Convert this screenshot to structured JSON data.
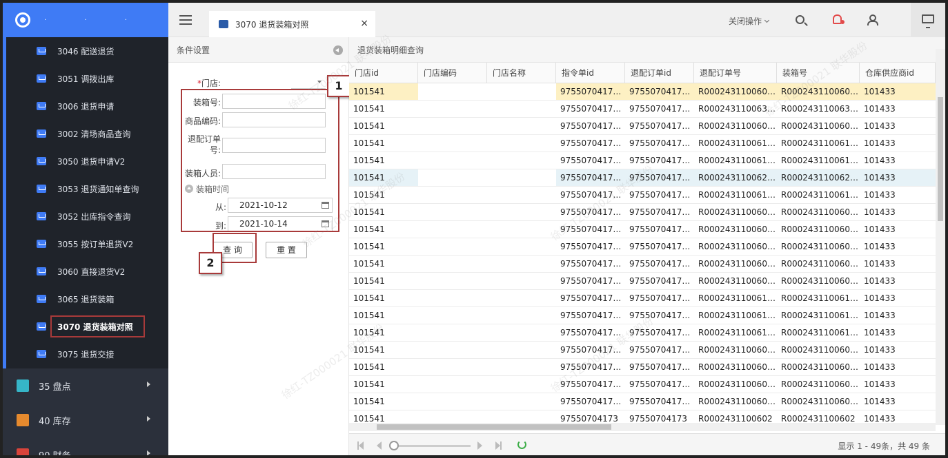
{
  "sidebar": {
    "logo_dots": "· · ·",
    "submenu": [
      {
        "label": "3046 配送退货"
      },
      {
        "label": "3051 调拨出库"
      },
      {
        "label": "3006 退货申请"
      },
      {
        "label": "3002 清场商品查询"
      },
      {
        "label": "3050 退货申请V2"
      },
      {
        "label": "3053 退货通知单查询"
      },
      {
        "label": "3052 出库指令查询"
      },
      {
        "label": "3055 按订单退货V2"
      },
      {
        "label": "3060 直接退货V2"
      },
      {
        "label": "3065 退货装箱"
      },
      {
        "label": "3070 退货装箱对照",
        "active": true
      },
      {
        "label": "3075 退货交接"
      }
    ],
    "groups": [
      {
        "label": "35 盘点",
        "color": "#36b5c8"
      },
      {
        "label": "40 库存",
        "color": "#e68a2e"
      },
      {
        "label": "90 财务",
        "color": "#d9443b"
      }
    ]
  },
  "topbar": {
    "tab_label": "3070 退货装箱对照",
    "tab_close": "×",
    "close_ops": "关闭操作"
  },
  "left_panel": {
    "title": "条件设置",
    "store_label": "门店:",
    "store_required": "*",
    "fields": [
      {
        "label": "装箱号:",
        "value": ""
      },
      {
        "label": "商品编码:",
        "value": ""
      },
      {
        "label": "退配订单号:",
        "value": ""
      },
      {
        "label": "装箱人员:",
        "value": ""
      }
    ],
    "time_group": "装箱时间",
    "from_label": "从:",
    "from_value": "2021-10-12",
    "to_label": "到:",
    "to_value": "2021-10-14",
    "query_btn": "查 询",
    "reset_btn": "重 置"
  },
  "callouts": [
    "1",
    "2"
  ],
  "right_panel": {
    "title": "退货装箱明细查询",
    "columns": [
      "门店id",
      "门店编码",
      "门店名称",
      "指令单id",
      "退配订单id",
      "退配订单号",
      "装箱号",
      "仓库供应商id"
    ],
    "rows": [
      [
        "101541",
        "",
        "",
        "97550704173...",
        "97550704173...",
        "R0002431100602...",
        "R0002431100602...",
        "101433"
      ],
      [
        "101541",
        "",
        "",
        "97550704173...",
        "97550704173...",
        "R0002431100636...",
        "R0002431100636...",
        "101433"
      ],
      [
        "101541",
        "",
        "",
        "97550704173...",
        "97550704173...",
        "R0002431100607...",
        "R0002431100607...",
        "101433"
      ],
      [
        "101541",
        "",
        "",
        "97550704173...",
        "97550704173...",
        "R0002431100612...",
        "R0002431100612...",
        "101433"
      ],
      [
        "101541",
        "",
        "",
        "97550704173...",
        "97550704173...",
        "R0002431100612...",
        "R0002431100612...",
        "101433"
      ],
      [
        "101541",
        "",
        "",
        "97550704173...",
        "97550704173...",
        "R0002431100621...",
        "R0002431100621...",
        "101433"
      ],
      [
        "101541",
        "",
        "",
        "97550704173...",
        "97550704173...",
        "R0002431100618...",
        "R0002431100618...",
        "101433"
      ],
      [
        "101541",
        "",
        "",
        "97550704173...",
        "97550704173...",
        "R0002431100603...",
        "R0002431100603...",
        "101433"
      ],
      [
        "101541",
        "",
        "",
        "97550704173...",
        "97550704173...",
        "R0002431100603...",
        "R0002431100603...",
        "101433"
      ],
      [
        "101541",
        "",
        "",
        "97550704173...",
        "97550704173...",
        "R0002431100603...",
        "R0002431100603...",
        "101433"
      ],
      [
        "101541",
        "",
        "",
        "97550704173...",
        "97550704173...",
        "R0002431100603...",
        "R0002431100603...",
        "101433"
      ],
      [
        "101541",
        "",
        "",
        "97550704173...",
        "97550704173...",
        "R0002431100603...",
        "R0002431100603...",
        "101433"
      ],
      [
        "101541",
        "",
        "",
        "97550704173...",
        "97550704173...",
        "R0002431100612...",
        "R0002431100612...",
        "101433"
      ],
      [
        "101541",
        "",
        "",
        "97550704173...",
        "97550704173...",
        "R0002431100612...",
        "R0002431100612...",
        "101433"
      ],
      [
        "101541",
        "",
        "",
        "97550704173...",
        "97550704173...",
        "R0002431100612...",
        "R0002431100612...",
        "101433"
      ],
      [
        "101541",
        "",
        "",
        "97550704173...",
        "97550704173...",
        "R0002431100607...",
        "R0002431100607...",
        "101433"
      ],
      [
        "101541",
        "",
        "",
        "97550704173...",
        "97550704173...",
        "R0002431100607...",
        "R0002431100607...",
        "101433"
      ],
      [
        "101541",
        "",
        "",
        "97550704173...",
        "97550704173...",
        "R0002431100607...",
        "R0002431100607...",
        "101433"
      ],
      [
        "101541",
        "",
        "",
        "97550704173...",
        "97550704173...",
        "R0002431100607...",
        "R0002431100607...",
        "101433"
      ],
      [
        "101541",
        "",
        "",
        "97550704173",
        "97550704173",
        "R0002431100602",
        "R0002431100602",
        "101433"
      ]
    ],
    "pager_info": "显示 1 - 49条，共 49 条"
  },
  "watermark": "徐红-TZ000021 联华股份"
}
